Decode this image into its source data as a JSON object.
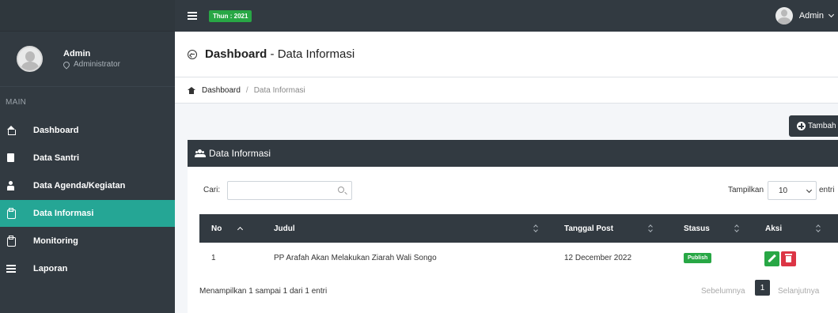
{
  "topbar": {
    "year_badge": "Thun : 2021",
    "user_name": "Admin"
  },
  "sidebar": {
    "user": {
      "name": "Admin",
      "role": "Administrator"
    },
    "section": "MAIN",
    "items": [
      {
        "label": "Dashboard",
        "icon": "home-icon"
      },
      {
        "label": "Data Santri",
        "icon": "book-icon"
      },
      {
        "label": "Data Agenda/Kegiatan",
        "icon": "person-icon"
      },
      {
        "label": "Data Informasi",
        "icon": "clipboard-icon",
        "active": true
      },
      {
        "label": "Monitoring",
        "icon": "clipboard-icon"
      },
      {
        "label": "Laporan",
        "icon": "list-icon"
      }
    ]
  },
  "header": {
    "title_bold": "Dashboard",
    "title_rest": " - Data Informasi"
  },
  "breadcrumb": {
    "home": "Dashboard",
    "separator": "/",
    "current": "Data Informasi"
  },
  "toolbar": {
    "add_label": "Tambah"
  },
  "card": {
    "title": "Data Informasi"
  },
  "filter": {
    "search_label": "Cari:",
    "search_value": "",
    "length_label": "Tampilkan",
    "length_value": "10",
    "length_suffix": "entri"
  },
  "table": {
    "columns": [
      "No",
      "Judul",
      "Tanggal Post",
      "Stasus",
      "Aksi"
    ],
    "rows": [
      {
        "no": "1",
        "judul": "PP Arafah Akan Melakukan Ziarah Wali Songo",
        "tanggal": "12 December 2022",
        "status": "Publish"
      }
    ]
  },
  "footer": {
    "info": "Menampilkan 1 sampai 1 dari 1 entri",
    "prev": "Sebelumnya",
    "page": "1",
    "next": "Selanjutnya"
  },
  "colors": {
    "sidebar_bg": "#323a41",
    "active": "#25a695",
    "success": "#28a745",
    "danger": "#dc3545"
  }
}
